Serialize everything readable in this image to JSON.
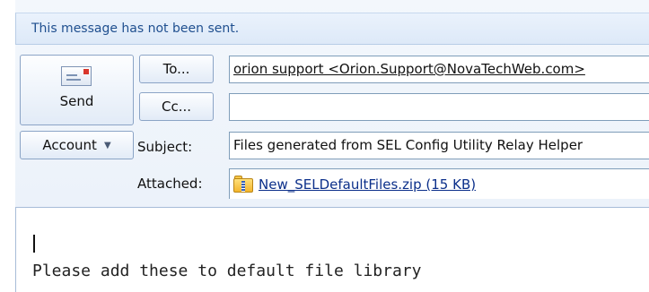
{
  "infobar": {
    "message": "This message has not been sent."
  },
  "toolbar": {
    "send_label": "Send",
    "account_label": "Account"
  },
  "header": {
    "to_label": "To...",
    "cc_label": "Cc...",
    "subject_label": "Subject:",
    "attached_label": "Attached:",
    "to_value": "orion support <Orion.Support@NovaTechWeb.com>",
    "cc_value": "",
    "subject_value": "Files generated from SEL Config Utility Relay Helper",
    "attachment": "New_SELDefaultFiles.zip (15 KB)"
  },
  "body": {
    "text": "Please add these to default file library"
  },
  "icons": {
    "send": "envelope-icon",
    "attachment": "zip-folder-icon",
    "account": "chevron-down-icon"
  }
}
